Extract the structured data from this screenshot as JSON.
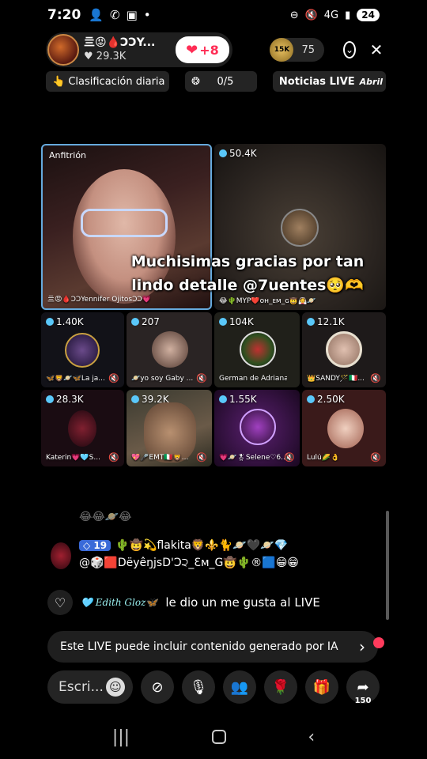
{
  "status_bar": {
    "time": "7:20",
    "battery": "24",
    "network": "4G"
  },
  "host": {
    "name": "亖😡🩸ƆƆY...",
    "likes": "29.3K",
    "follow_count": "+8"
  },
  "viewers": {
    "badge": "15K",
    "count": "75"
  },
  "info_row": {
    "daily_ranking": "Clasificación diaria",
    "progress": "0/5",
    "news": "Noticias LIVE",
    "month": "Abril"
  },
  "tiles": [
    {
      "label": "Anfitrión",
      "name": "亖😡🩸ƆƆYennifer OjitosƆƆ💗"
    },
    {
      "count": "50.4K",
      "name": "😂🌵MYP❤️ᴏʜ_ᴇᴍ_ɢ🤠👰🪐"
    },
    {
      "count": "1.40K",
      "name": "🦋🦁🪐🦋La ja..."
    },
    {
      "count": "207",
      "name": "🪐yo soy Gaby ..."
    },
    {
      "count": "104K",
      "name": "German de Adriana ..."
    },
    {
      "count": "12.1K",
      "name": "👑SANDY🪄🇮🇹..."
    },
    {
      "count": "28.3K",
      "name": "Katerin💗🩵S..."
    },
    {
      "count": "39.2K",
      "name": "💖🎤EMT🇮🇹🦁..."
    },
    {
      "count": "1.55K",
      "name": "💗🪐🎖Selene♡6..."
    },
    {
      "count": "2.50K",
      "name": "Lulú🌽👌"
    }
  ],
  "caption": "Muchisimas gracias por tan lindo detalle @7uentes🥺🫶",
  "chat": {
    "partial": "😂😂🪐😂",
    "level": "19",
    "line1": "🌵🤠💫flakita🦁⚜️🐈🪐🖤🪐💎",
    "line2": "@🎲🟥DëyêŋjsD'Ɔ੨_Ɛᴍ_G🤠🌵®🟦😁😁"
  },
  "like_notice": {
    "user": "🩵 Edith Gloz🦋",
    "text": "le dio un me gusta al LIVE"
  },
  "ai_banner": "Este LIVE puede incluir contenido generado por IA",
  "toolbar": {
    "comment_placeholder": "Escri...",
    "share_count": "150"
  }
}
